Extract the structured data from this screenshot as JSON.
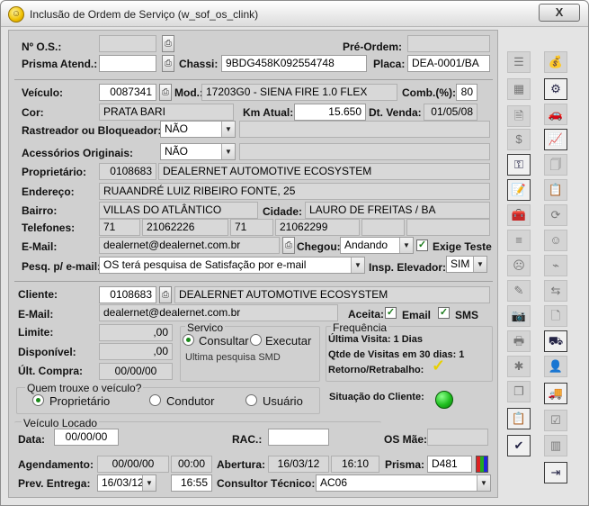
{
  "window": {
    "title": "Inclusão de Ordem de Serviço (w_sof_os_clink)",
    "close_glyph": "X"
  },
  "os": {
    "label": "Nº O.S.:",
    "value": ""
  },
  "pre_ordem": {
    "label": "Pré-Ordem:",
    "value": ""
  },
  "prisma_atend": {
    "label": "Prisma Atend.:",
    "value": ""
  },
  "chassi": {
    "label": "Chassi:",
    "value": "9BDG458K092554748"
  },
  "placa": {
    "label": "Placa:",
    "value": "DEA-0001/BA"
  },
  "veiculo": {
    "label": "Veículo:",
    "value": "0087341"
  },
  "mod": {
    "label": "Mod.:",
    "value": "17203G0 - SIENA FIRE 1.0 FLEX"
  },
  "comb": {
    "label": "Comb.(%):",
    "value": "80"
  },
  "cor": {
    "label": "Cor:",
    "value": "PRATA BARI"
  },
  "km_atual": {
    "label": "Km Atual:",
    "value": "15.650"
  },
  "dt_venda": {
    "label": "Dt. Venda:",
    "value": "01/05/08"
  },
  "rastreador": {
    "label": "Rastreador ou Bloqueador:",
    "value": "NÃO"
  },
  "acessorios": {
    "label": "Acessórios Originais:",
    "value": "NÃO"
  },
  "proprietario": {
    "label": "Proprietário:",
    "code": "0108683",
    "name": "DEALERNET AUTOMOTIVE ECOSYSTEM"
  },
  "endereco": {
    "label": "Endereço:",
    "value": "RUAANDRÉ LUIZ RIBEIRO FONTE, 25"
  },
  "bairro": {
    "label": "Bairro:",
    "value": "VILLAS DO ATLÂNTICO"
  },
  "cidade": {
    "label": "Cidade:",
    "value": "LAURO DE FREITAS / BA"
  },
  "telefones": {
    "label": "Telefones:",
    "ddd1": "71",
    "tel1": "21062226",
    "ddd2": "71",
    "tel2": "21062299"
  },
  "email_veic": {
    "label": "E-Mail:",
    "value": "dealernet@dealernet.com.br"
  },
  "chegou": {
    "label": "Chegou:",
    "value": "Andando"
  },
  "exige_teste": {
    "label": "Exige Teste",
    "checked": true
  },
  "pesq_email": {
    "label": "Pesq. p/ e-mail:",
    "value": "OS terá pesquisa de Satisfação por e-mail"
  },
  "insp_elevador": {
    "label": "Insp. Elevador:",
    "value": "SIM"
  },
  "cliente": {
    "label": "Cliente:",
    "code": "0108683",
    "name": "DEALERNET AUTOMOTIVE ECOSYSTEM"
  },
  "email_cli": {
    "label": "E-Mail:",
    "value": "dealernet@dealernet.com.br"
  },
  "aceita": {
    "label": "Aceita:",
    "email_label": "Email",
    "sms_label": "SMS"
  },
  "limite": {
    "label": "Limite:",
    "value": ",00"
  },
  "disponivel": {
    "label": "Disponível:",
    "value": ",00"
  },
  "ult_compra": {
    "label": "Últ. Compra:",
    "value": "00/00/00"
  },
  "servico": {
    "title": "Servico",
    "opt1": "Consultar",
    "opt2": "Executar",
    "note": "Ultima pesquisa SMD"
  },
  "frequencia": {
    "title": "Frequência",
    "ultima_visita": "Última Visita: 1 Dias",
    "qtde_visitas": "Qtde de Visitas em 30 dias: 1",
    "retorno": "Retorno/Retrabalho:"
  },
  "quem_trouxe": {
    "title": "Quem trouxe o veículo?",
    "opt1": "Proprietário",
    "opt2": "Condutor",
    "opt3": "Usuário"
  },
  "situacao": {
    "label": "Situação do Cliente:"
  },
  "veiculo_locado": {
    "title": "Veículo Locado",
    "data_label": "Data:",
    "data_value": "00/00/00",
    "rac_label": "RAC.:",
    "rac_value": "",
    "os_mae_label": "OS Mãe:",
    "os_mae_value": ""
  },
  "agendamento": {
    "label": "Agendamento:",
    "date": "00/00/00",
    "time": "00:00"
  },
  "abertura": {
    "label": "Abertura:",
    "date": "16/03/12",
    "time": "16:10"
  },
  "prisma": {
    "label": "Prisma:",
    "value": "D481"
  },
  "prev_entrega": {
    "label": "Prev. Entrega:",
    "date": "16/03/12",
    "time": "16:55"
  },
  "consultor": {
    "label": "Consultor Técnico:",
    "value": "AC06"
  },
  "toolbar_left": [
    {
      "icon": "list-icon",
      "glyph": "☰"
    },
    {
      "icon": "table-icon",
      "glyph": "▦"
    },
    {
      "icon": "document-search-icon",
      "glyph": "🗎"
    },
    {
      "icon": "money-icon",
      "glyph": "$"
    },
    {
      "icon": "car-key-icon",
      "glyph": "⚿"
    },
    {
      "icon": "notes-icon",
      "glyph": "📝"
    },
    {
      "icon": "toolbox-icon",
      "glyph": "🧰"
    },
    {
      "icon": "lines-icon",
      "glyph": "≡"
    },
    {
      "icon": "sad-face-icon",
      "glyph": "☹"
    },
    {
      "icon": "pencil-icon",
      "glyph": "✎"
    },
    {
      "icon": "camera-icon",
      "glyph": "📷"
    },
    {
      "icon": "printer-icon",
      "glyph": "🖶"
    },
    {
      "icon": "bug-icon",
      "glyph": "✱"
    },
    {
      "icon": "copy-icon",
      "glyph": "❐"
    },
    {
      "icon": "notepad-icon",
      "glyph": "📋"
    },
    {
      "icon": "check-doc-icon",
      "glyph": "✔"
    }
  ],
  "toolbar_right": [
    {
      "icon": "money-bag-icon",
      "glyph": "💰"
    },
    {
      "icon": "parts-icon",
      "glyph": "⚙"
    },
    {
      "icon": "car-icon",
      "glyph": "🚗"
    },
    {
      "icon": "chart-icon",
      "glyph": "📈"
    },
    {
      "icon": "pages-icon",
      "glyph": "🗍"
    },
    {
      "icon": "clipboard-icon",
      "glyph": "📋"
    },
    {
      "icon": "refresh-icon",
      "glyph": "⟳"
    },
    {
      "icon": "smile-face-icon",
      "glyph": "☺"
    },
    {
      "icon": "hose-icon",
      "glyph": "⌁"
    },
    {
      "icon": "merge-icon",
      "glyph": "⇆"
    },
    {
      "icon": "doc-icon",
      "glyph": "🗋"
    },
    {
      "icon": "car-wash-icon",
      "glyph": "⛟"
    },
    {
      "icon": "person-icon",
      "glyph": "👤"
    },
    {
      "icon": "truck-icon",
      "glyph": "🚚"
    },
    {
      "icon": "checklist-icon",
      "glyph": "☑"
    },
    {
      "icon": "memory-icon",
      "glyph": "▥"
    },
    {
      "icon": "exit-icon",
      "glyph": "⇥"
    }
  ]
}
